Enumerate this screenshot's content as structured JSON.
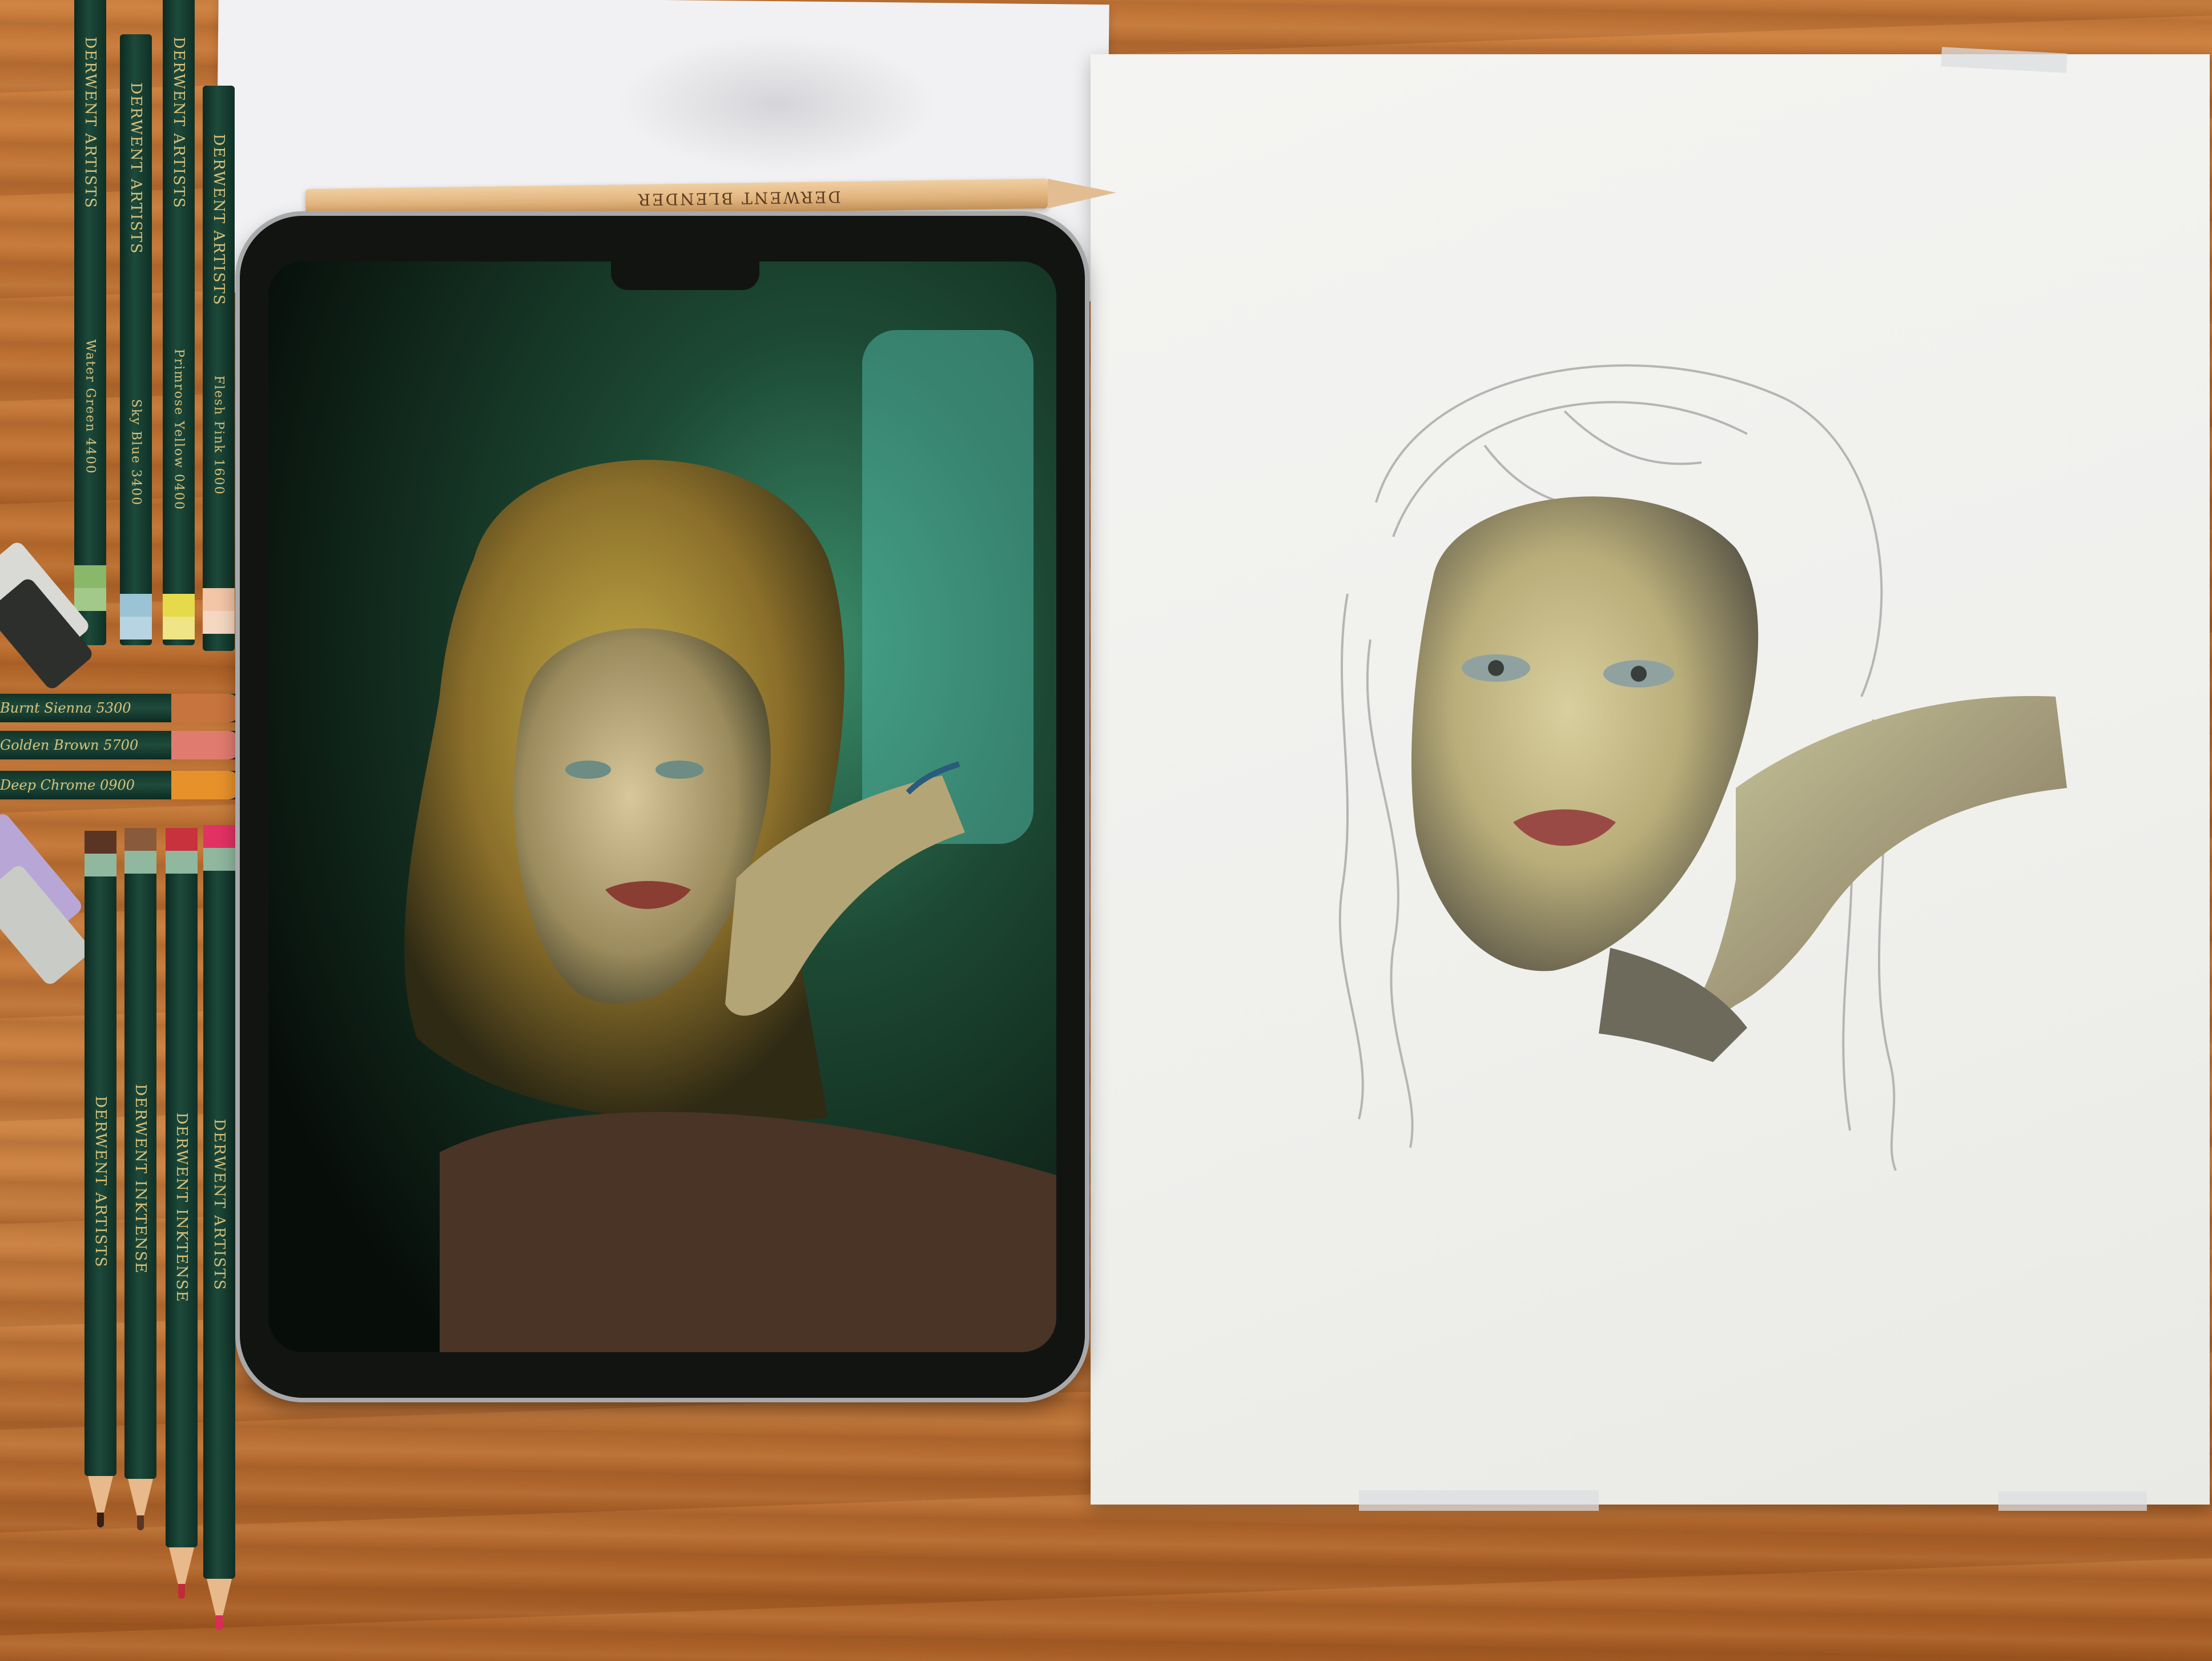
{
  "scene": {
    "table_color": "#bf7535",
    "paper_color": "#f0f0ee",
    "tablet_frame_color": "#a8a9ab",
    "screen_tone": "#2f5a3a"
  },
  "pencils": [
    {
      "label": "DERWENT ARTISTS",
      "name": "Water Green 4400",
      "band": "#8ab86a",
      "lead": "#7bb061"
    },
    {
      "label": "DERWENT ARTISTS",
      "name": "Sky Blue 3400",
      "band": "#9bc3d6",
      "lead": "#8fb6cc"
    },
    {
      "label": "DERWENT ARTISTS",
      "name": "Primrose Yellow 0400",
      "band": "#e6d94a",
      "lead": "#e5d23c"
    },
    {
      "label": "DERWENT ARTISTS",
      "name": "Flesh Pink 1600",
      "band": "#f2c6a7",
      "lead": "#eebb9a"
    }
  ],
  "side_pencils": [
    {
      "label": "Burnt Sienna 5300",
      "end": "#c8743e"
    },
    {
      "label": "Golden Brown 5700",
      "end": "#e07c6f"
    },
    {
      "label": "Deep Chrome 0900",
      "end": "#e7912b"
    }
  ],
  "lower_pencils": [
    {
      "label": "DERWENT ARTISTS",
      "band": "#5a3524",
      "lead": "#3a1e12"
    },
    {
      "label": "DERWENT INKTENSE",
      "band": "#8a5a3c",
      "lead": "#5a3424"
    },
    {
      "label": "DERWENT INKTENSE",
      "band": "#c8323c",
      "lead": "#c12a38"
    },
    {
      "label": "DERWENT ARTISTS",
      "band": "#e23264",
      "lead": "#dc2a5a"
    }
  ],
  "blender_pencil": {
    "label": "DERWENT BLENDER"
  }
}
